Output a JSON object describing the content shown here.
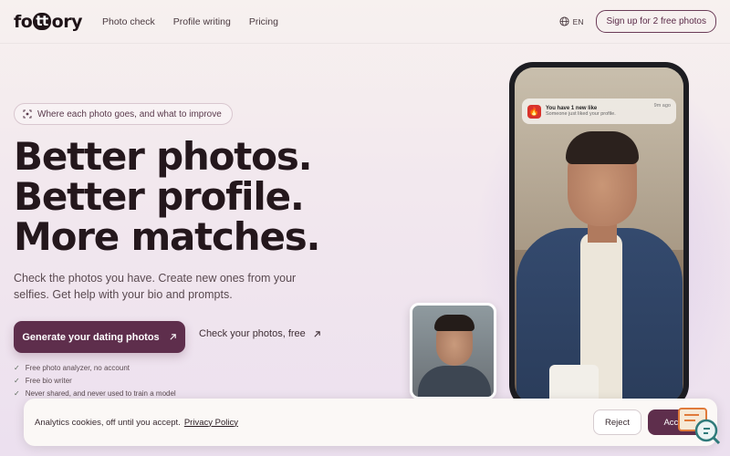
{
  "header": {
    "logo": {
      "pre": "fo",
      "mark": "tt",
      "post": "ory"
    },
    "nav": [
      "Photo check",
      "Profile writing",
      "Pricing"
    ],
    "lang": "EN",
    "cta": "Sign up for 2 free photos"
  },
  "hero": {
    "pill": "Where each photo goes, and what to improve",
    "headline": [
      "Better photos.",
      "Better profile.",
      "More matches."
    ],
    "sub": "Check the photos you have. Create new ones from your selfies. Get help with your bio and prompts.",
    "primary": "Generate your dating photos",
    "secondary": "Check your photos, free",
    "checks": [
      "Free photo analyzer, no account",
      "Free bio writer",
      "Never shared, and never used to train a model"
    ]
  },
  "phone": {
    "notif_title": "You have 1 new like",
    "notif_body": "Someone just liked your profile.",
    "notif_time": "9m ago"
  },
  "cookie": {
    "message": "Analytics cookies, off until you accept.",
    "policy": "Privacy Policy",
    "reject": "Reject",
    "accept": "Accept"
  },
  "colors": {
    "brand": "#5e2e4c",
    "text": "#24171c",
    "notif_app": "#d8322b"
  },
  "icons": [
    "globe-icon",
    "scan-icon",
    "arrow-up-right-icon",
    "check-icon",
    "flame-icon",
    "chat-search-icon"
  ]
}
